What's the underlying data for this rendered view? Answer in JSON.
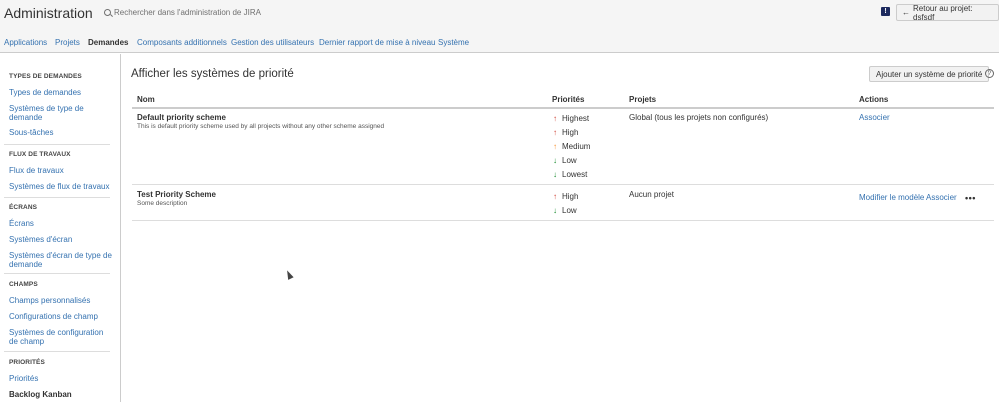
{
  "header": {
    "app_title": "Administration",
    "search_placeholder": "Rechercher dans l'administration de JIRA",
    "back_button": "Retour au projet: dsfsdf"
  },
  "nav": {
    "tabs": [
      {
        "label": "Applications"
      },
      {
        "label": "Projets"
      },
      {
        "label": "Demandes",
        "active": true
      },
      {
        "label": "Composants additionnels"
      },
      {
        "label": "Gestion des utilisateurs"
      },
      {
        "label": "Dernier rapport de mise à niveau"
      },
      {
        "label": "Système"
      }
    ]
  },
  "sidebar": {
    "sections": [
      {
        "heading": "TYPES DE DEMANDES",
        "items": [
          "Types de demandes",
          "Systèmes de type de demande",
          "Sous-tâches"
        ]
      },
      {
        "heading": "FLUX DE TRAVAUX",
        "items": [
          "Flux de travaux",
          "Systèmes de flux de travaux"
        ]
      },
      {
        "heading": "ÉCRANS",
        "items": [
          "Écrans",
          "Systèmes d'écran",
          "Systèmes d'écran de type de demande"
        ]
      },
      {
        "heading": "CHAMPS",
        "items": [
          "Champs personnalisés",
          "Configurations de champ",
          "Systèmes de configuration de champ"
        ]
      },
      {
        "heading": "PRIORITÉS",
        "items": [
          "Priorités",
          "Backlog Kanban"
        ]
      }
    ]
  },
  "main": {
    "title": "Afficher les systèmes de priorité",
    "add_button": "Ajouter un système de priorité",
    "help_icon": "?",
    "columns": {
      "name": "Nom",
      "priorities": "Priorités",
      "projects": "Projets",
      "actions": "Actions"
    },
    "schemes": [
      {
        "name": "Default priority scheme",
        "description": "This is default priority scheme used by all projects without any other scheme assigned",
        "priorities": [
          {
            "label": "Highest",
            "icon": "arrow-up-icon",
            "color": "#d04437"
          },
          {
            "label": "High",
            "icon": "arrow-up-icon",
            "color": "#d04437"
          },
          {
            "label": "Medium",
            "icon": "arrow-up-icon",
            "color": "#f79232"
          },
          {
            "label": "Low",
            "icon": "arrow-down-icon",
            "color": "#14892c"
          },
          {
            "label": "Lowest",
            "icon": "arrow-down-icon",
            "color": "#14892c"
          }
        ],
        "projects": "Global (tous les projets non configurés)",
        "actions": [
          "Associer"
        ]
      },
      {
        "name": "Test Priority Scheme",
        "description": "Some description",
        "priorities": [
          {
            "label": "High",
            "icon": "arrow-up-icon",
            "color": "#d04437"
          },
          {
            "label": "Low",
            "icon": "arrow-down-icon",
            "color": "#14892c"
          }
        ],
        "projects": "Aucun projet",
        "actions": [
          "Modifier le modèle",
          "Associer"
        ]
      }
    ]
  }
}
